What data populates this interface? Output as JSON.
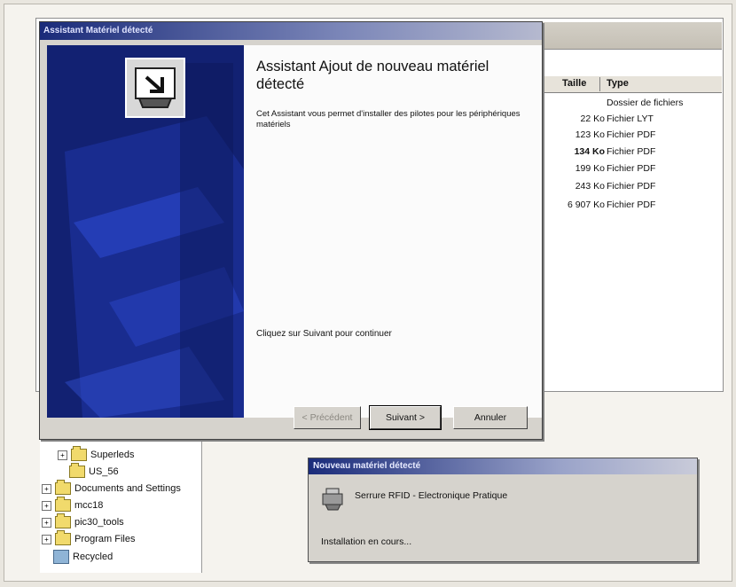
{
  "wizard": {
    "title": "Assistant Matériel détecté",
    "heading": "Assistant Ajout de nouveau matériel détecté",
    "description": "Cet Assistant vous permet d'installer des pilotes pour les périphériques matériels",
    "continue_hint": "Cliquez sur Suivant pour continuer",
    "buttons": {
      "back": "< Précédent",
      "next": "Suivant >",
      "cancel": "Annuler"
    },
    "icon": "hardware-install-icon"
  },
  "explorer": {
    "columns": {
      "size": "Taille",
      "type": "Type"
    },
    "files": [
      {
        "size": "",
        "type": "Dossier de fichiers"
      },
      {
        "size": "22 Ko",
        "type": "Fichier LYT"
      },
      {
        "size": "123 Ko",
        "type": "Fichier PDF"
      },
      {
        "size": "134 Ko",
        "type": "Fichier PDF"
      },
      {
        "size": "199 Ko",
        "type": "Fichier PDF"
      },
      {
        "size": "243 Ko",
        "type": "Fichier PDF"
      },
      {
        "size": "6 907 Ko",
        "type": "Fichier PDF"
      }
    ]
  },
  "tree": {
    "items": [
      {
        "label": "Superleds",
        "expander": "+"
      },
      {
        "label": "US_56",
        "expander": ""
      },
      {
        "label": "Documents and Settings",
        "expander": "+"
      },
      {
        "label": "mcc18",
        "expander": "+"
      },
      {
        "label": "pic30_tools",
        "expander": "+"
      },
      {
        "label": "Program Files",
        "expander": "+"
      },
      {
        "label": "Recycled",
        "expander": ""
      }
    ]
  },
  "popup": {
    "title": "Nouveau matériel détecté",
    "device": "Serrure RFID - Electronique Pratique",
    "status": "Installation en cours..."
  }
}
